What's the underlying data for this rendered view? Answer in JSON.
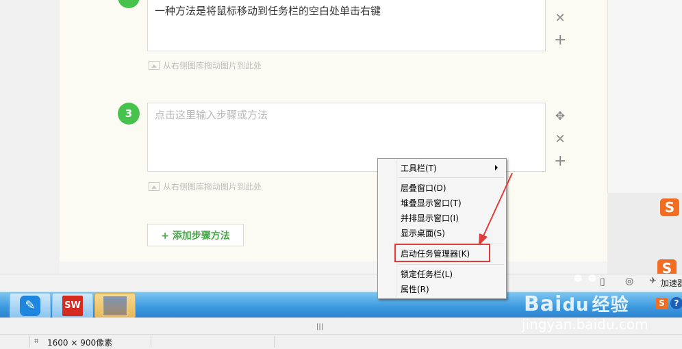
{
  "steps": [
    {
      "text": "一种方法是将鼠标移动到任务栏的空白处单击右键",
      "image_hint": "从右侧图库拖动图片到此处"
    },
    {
      "number": "3",
      "placeholder": "点击这里输入步骤或方法",
      "image_hint": "从右侧图库拖动图片到此处"
    }
  ],
  "add_step_label": "+ 添加步骤方法",
  "context_menu": {
    "items": [
      {
        "label": "工具栏(T)",
        "submenu": true
      },
      {
        "label": "层叠窗口(D)"
      },
      {
        "label": "堆叠显示窗口(T)"
      },
      {
        "label": "并排显示窗口(I)"
      },
      {
        "label": "显示桌面(S)"
      },
      {
        "label": "启动任务管理器(K)",
        "highlighted": true
      },
      {
        "label": "锁定任务栏(L)"
      },
      {
        "label": "属性(R)"
      }
    ]
  },
  "tray": {
    "accelerate_label": "加速器"
  },
  "status_bar": {
    "resolution": "1600 × 900像素"
  },
  "watermark": {
    "brand": "Bai",
    "brand_end": "经验",
    "url": "jingyan.baidu.com"
  },
  "sogou_label": "S",
  "taskbar": {
    "sw_label": "SW"
  },
  "colors": {
    "accent_green": "#46c24d",
    "highlight_red": "#e23a3a",
    "taskbar_blue": "#3d9be0"
  }
}
